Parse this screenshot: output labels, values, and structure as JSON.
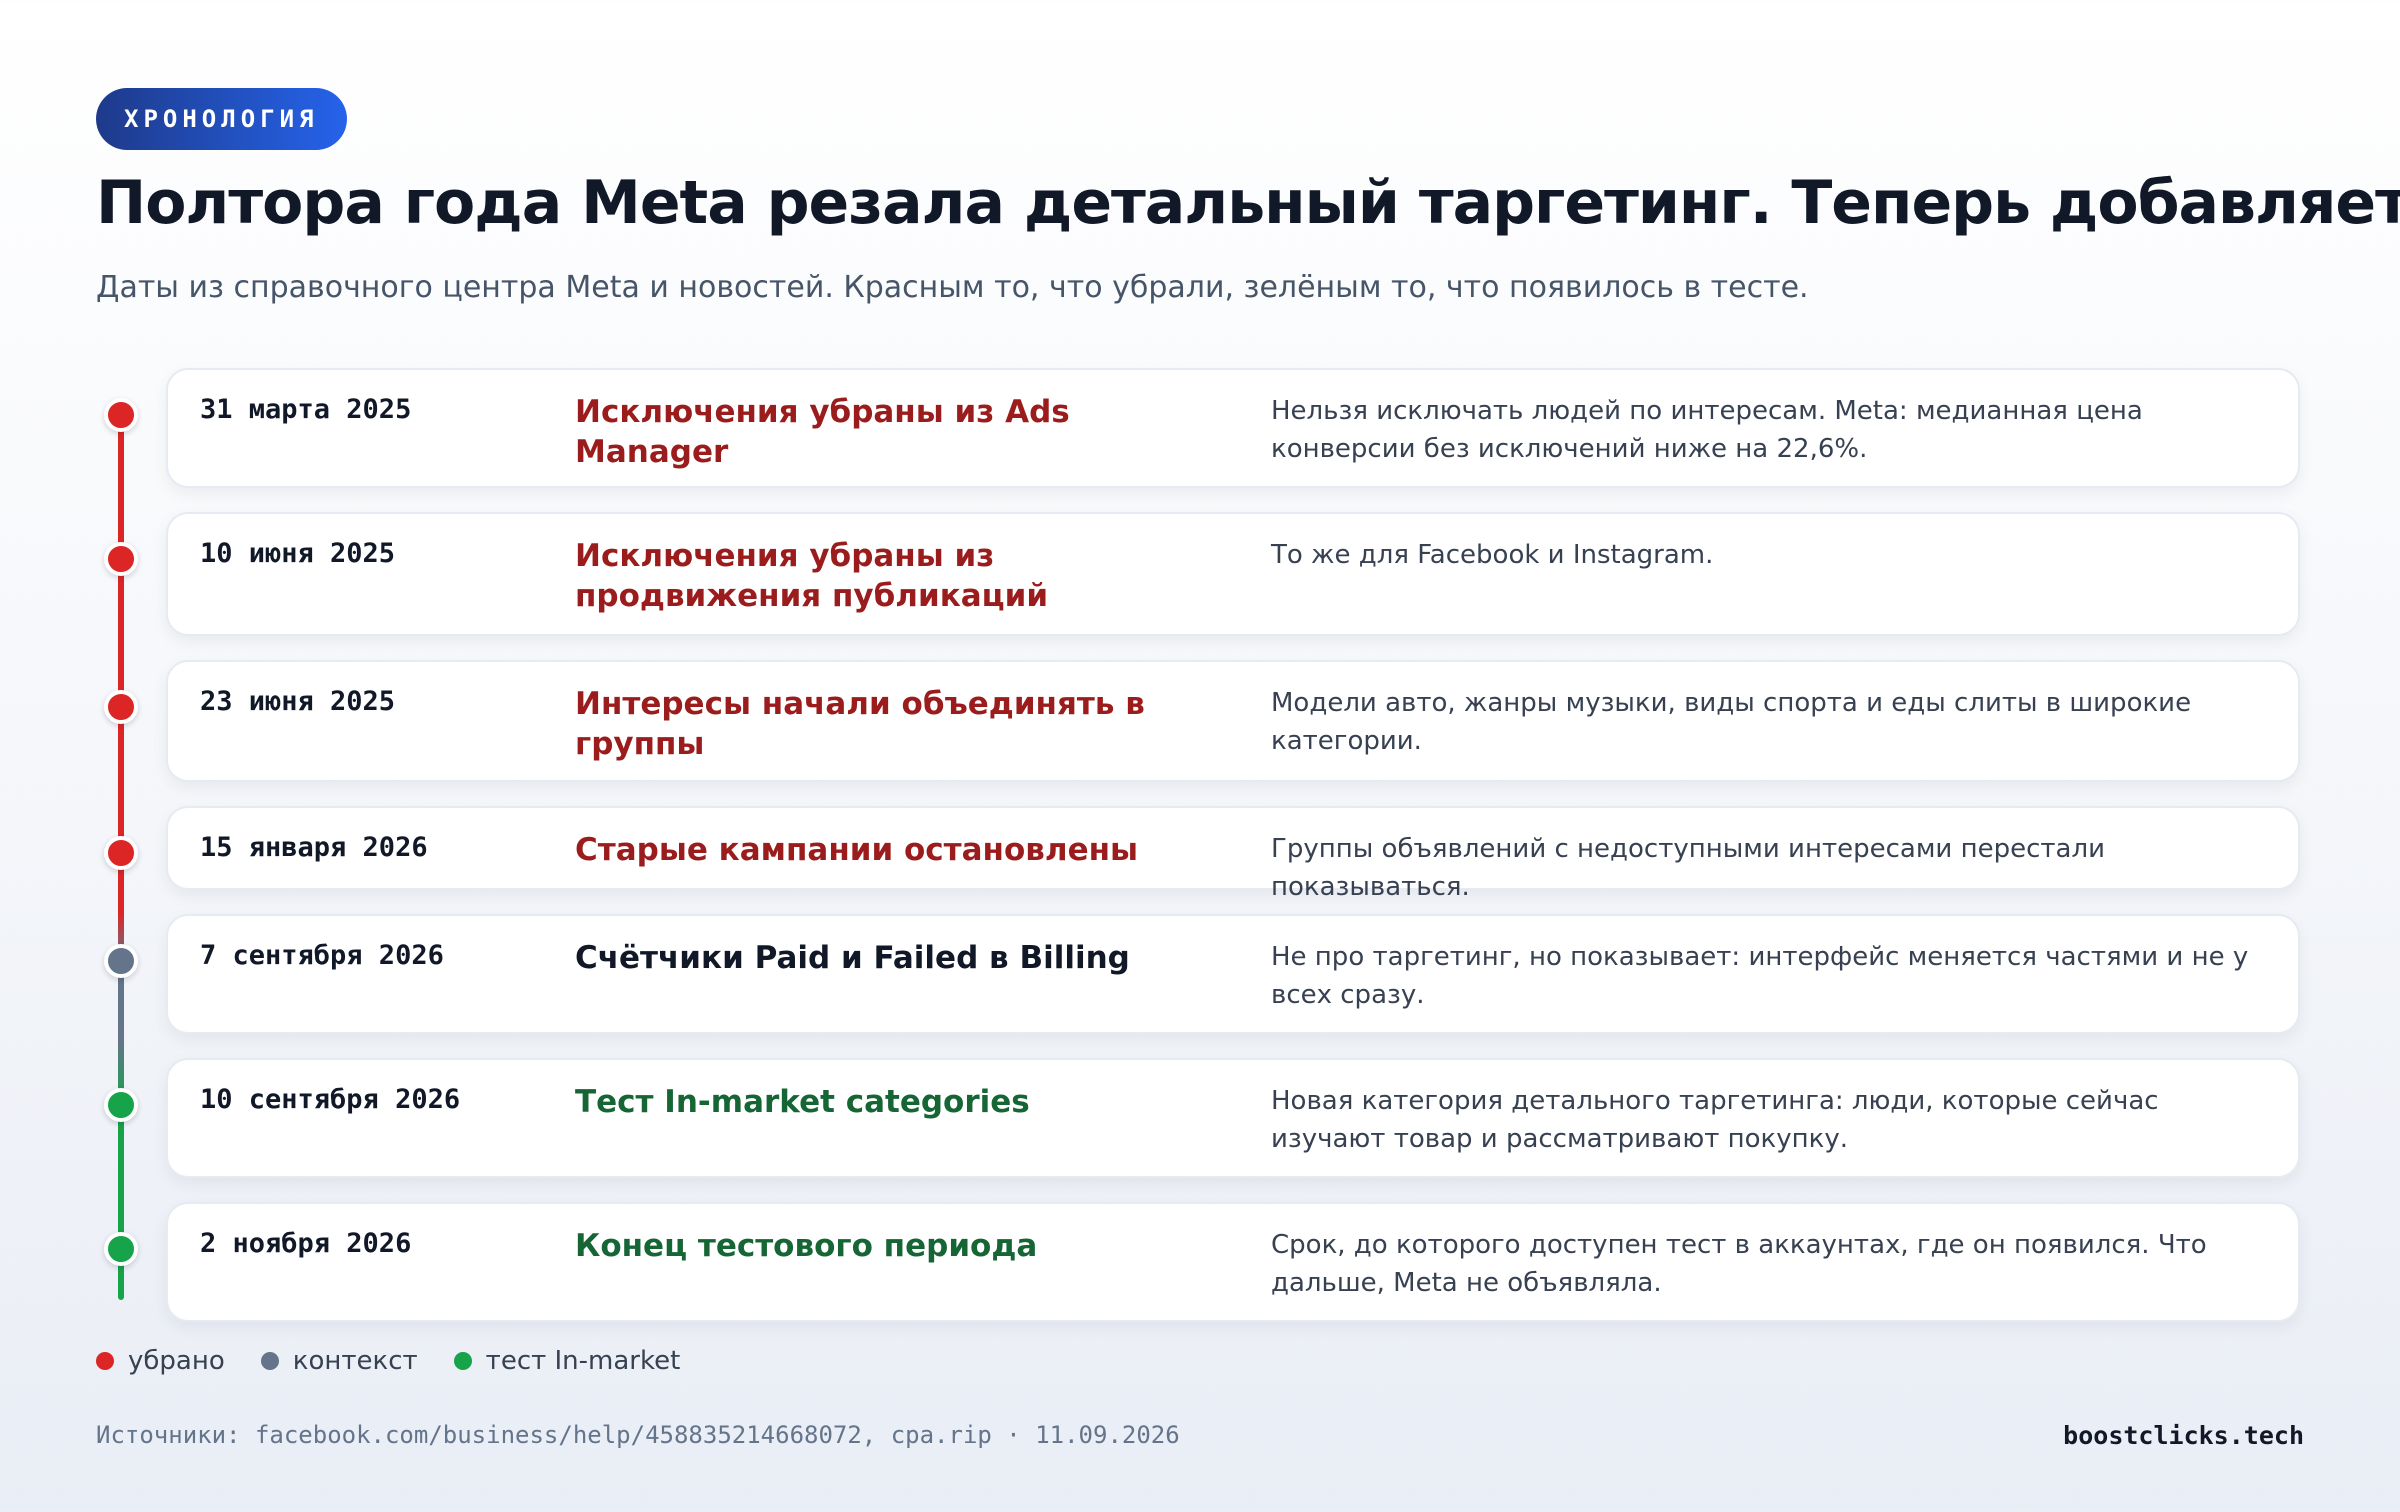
{
  "badge": "ХРОНОЛОГИЯ",
  "title": "Полтора года Meta резала детальный таргетинг. Теперь добавляет",
  "subtitle": "Даты из справочного центра Meta и новостей. Красным то, что убрали, зелёным то, что появилось в тесте.",
  "colors": {
    "removed": "#dc2626",
    "context": "#64748b",
    "test": "#16a34a",
    "removed_text": "#9b1c1c",
    "context_text": "#111827",
    "test_text": "#166534",
    "badge_from": "#1e3a8a",
    "badge_to": "#2563eb"
  },
  "events": [
    {
      "date": "31 марта 2025",
      "title": "Исключения убраны из Ads Manager",
      "description": "Нельзя исключать людей по интересам. Meta: медианная цена конверсии без исключений ниже на 22,6%.",
      "kind": "removed"
    },
    {
      "date": "10 июня 2025",
      "title": "Исключения убраны из продвижения публикаций",
      "description": "То же для Facebook и Instagram.",
      "kind": "removed"
    },
    {
      "date": "23 июня 2025",
      "title": "Интересы начали объединять в группы",
      "description": "Модели авто, жанры музыки, виды спорта и еды слиты в широкие категории.",
      "kind": "removed"
    },
    {
      "date": "15 января 2026",
      "title": "Старые кампании остановлены",
      "description": "Группы объявлений с недоступными интересами перестали показываться.",
      "kind": "removed"
    },
    {
      "date": "7 сентября 2026",
      "title": "Счётчики Paid и Failed в Billing",
      "description": "Не про таргетинг, но показывает: интерфейс меняется частями и не у всех сразу.",
      "kind": "context"
    },
    {
      "date": "10 сентября 2026",
      "title": "Тест In-market categories",
      "description": "Новая категория детального таргетинга: люди, которые сейчас изучают товар и рассматривают покупку.",
      "kind": "test"
    },
    {
      "date": "2 ноября 2026",
      "title": "Конец тестового периода",
      "description": "Срок, до которого доступен тест в аккаунтах, где он появился. Что дальше, Meta не объявляла.",
      "kind": "test"
    }
  ],
  "legend": [
    {
      "label": "убрано",
      "kind": "removed"
    },
    {
      "label": "контекст",
      "kind": "context"
    },
    {
      "label": "тест In-market",
      "kind": "test"
    }
  ],
  "footer": {
    "sources": "Источники: facebook.com/business/help/458835214668072, cpa.rip · 11.09.2026",
    "brand": "boostclicks.tech"
  }
}
